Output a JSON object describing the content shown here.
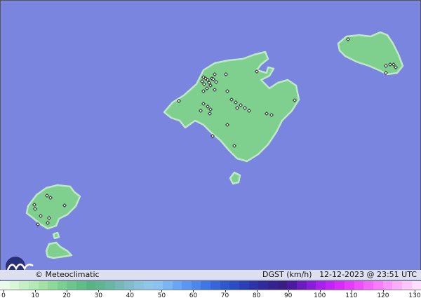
{
  "brand": {
    "name": "© Meteoclimatic",
    "logo": "meteoclimatic-logo"
  },
  "info": {
    "variable": "DGST (km/h)",
    "timestamp": "12-12-2023 @ 23:51 UTC"
  },
  "colors": {
    "sea": "#7a85e0",
    "land": "#7fcf8f",
    "coast": "#bfe8c5",
    "station": "#1a1a1a"
  },
  "scale": {
    "ticks": [
      "0",
      "10",
      "20",
      "30",
      "40",
      "50",
      "60",
      "70",
      "80",
      "90",
      "100",
      "110",
      "120",
      "130"
    ],
    "colors": [
      "#e9fbe9",
      "#d9f6d9",
      "#c5f0c5",
      "#b3eab3",
      "#a3e2a5",
      "#8dd99a",
      "#7ad093",
      "#6cc68c",
      "#5fbd86",
      "#56b482",
      "#5eb590",
      "#68b7a4",
      "#74b8b8",
      "#80bccc",
      "#88c3dd",
      "#8fc7ea",
      "#8ac3f0",
      "#7ab6f4",
      "#6aa6f6",
      "#5a96f4",
      "#4c86ef",
      "#3f76e8",
      "#3566dd",
      "#2e58d0",
      "#2a4cc4",
      "#2a40b8",
      "#2c34ac",
      "#2f2a9d",
      "#34238f",
      "#3a1d82",
      "#4a1ba0",
      "#6a1cc0",
      "#8a1ddc",
      "#a81ff0",
      "#c423f6",
      "#d82bfa",
      "#e83afc",
      "#f04efc",
      "#f564fb",
      "#f87cfb",
      "#fa96fb",
      "#fcaefb",
      "#fdc7fc",
      "#fedffd"
    ]
  },
  "stations": [
    [
      255,
      144
    ],
    [
      290,
      110
    ],
    [
      293,
      112
    ],
    [
      288,
      116
    ],
    [
      296,
      114
    ],
    [
      291,
      120
    ],
    [
      298,
      118
    ],
    [
      302,
      112
    ],
    [
      306,
      106
    ],
    [
      304,
      113
    ],
    [
      308,
      117
    ],
    [
      300,
      122
    ],
    [
      295,
      126
    ],
    [
      290,
      130
    ],
    [
      306,
      128
    ],
    [
      324,
      130
    ],
    [
      330,
      142
    ],
    [
      336,
      146
    ],
    [
      343,
      150
    ],
    [
      338,
      154
    ],
    [
      349,
      154
    ],
    [
      355,
      158
    ],
    [
      290,
      148
    ],
    [
      296,
      152
    ],
    [
      286,
      158
    ],
    [
      300,
      156
    ],
    [
      299,
      162
    ],
    [
      380,
      162
    ],
    [
      387,
      164
    ],
    [
      322,
      106
    ],
    [
      366,
      102
    ],
    [
      324,
      178
    ],
    [
      420,
      143
    ],
    [
      303,
      194
    ],
    [
      334,
      208
    ],
    [
      496,
      56
    ],
    [
      550,
      94
    ],
    [
      556,
      92
    ],
    [
      561,
      92
    ],
    [
      564,
      96
    ],
    [
      550,
      104
    ],
    [
      67,
      279
    ],
    [
      72,
      282
    ],
    [
      49,
      292
    ],
    [
      50,
      298
    ],
    [
      92,
      293
    ],
    [
      58,
      308
    ],
    [
      70,
      311
    ],
    [
      68,
      318
    ],
    [
      54,
      320
    ]
  ]
}
